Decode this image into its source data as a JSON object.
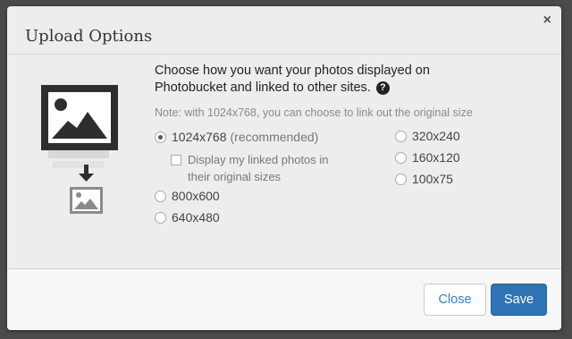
{
  "dialog": {
    "title": "Upload Options",
    "close_symbol": "×",
    "heading": "Choose how you want your photos displayed on Photobucket and linked to other sites.",
    "help_symbol": "?",
    "note": "Note: with 1024x768, you can choose to link out the original size",
    "left_options": [
      {
        "label": "1024x768",
        "suffix": "(recommended)",
        "selected": true
      },
      {
        "label": "800x600",
        "selected": false
      },
      {
        "label": "640x480",
        "selected": false
      }
    ],
    "right_options": [
      {
        "label": "320x240",
        "selected": false
      },
      {
        "label": "160x120",
        "selected": false
      },
      {
        "label": "100x75",
        "selected": false
      }
    ],
    "checkbox": {
      "label": "Display my linked photos in their original sizes",
      "checked": false
    },
    "buttons": {
      "close": "Close",
      "save": "Save"
    }
  },
  "icons": {
    "illustration": "photo-resize-icon",
    "help": "help-icon",
    "close": "close-icon"
  },
  "colors": {
    "primary_button": "#2f73b5",
    "link_text": "#3a7ec0",
    "icon": "#2e2e2e"
  }
}
